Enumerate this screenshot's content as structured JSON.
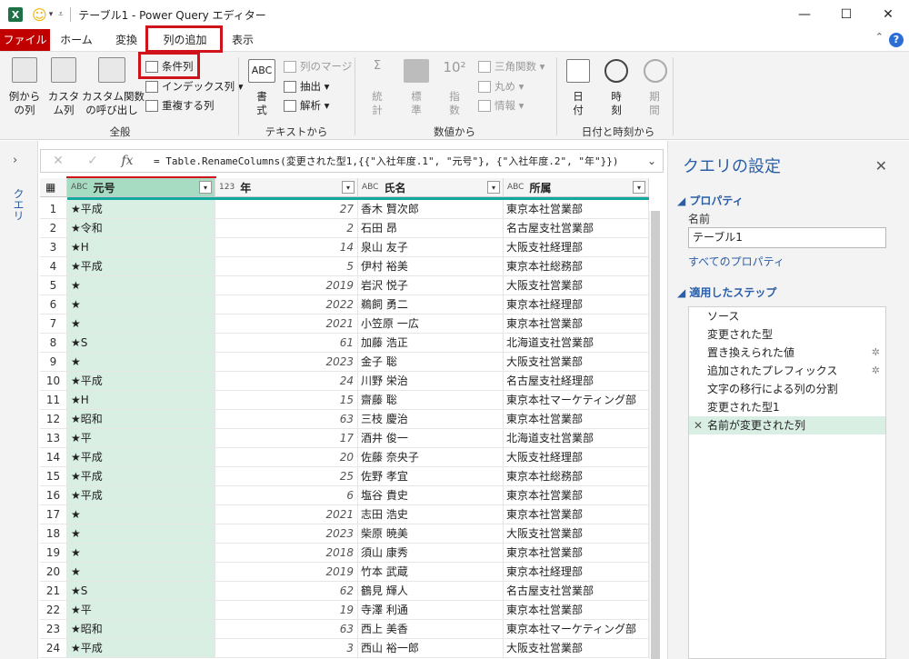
{
  "window": {
    "title": "テーブル1 - Power Query エディター",
    "app_icon": "X",
    "minimize": "—",
    "maximize": "☐",
    "close": "✕"
  },
  "menu": {
    "file": "ファイル",
    "home": "ホーム",
    "transform": "変換",
    "add_column": "列の追加",
    "view": "表示"
  },
  "ribbon": {
    "example_col": "例から\nの列",
    "custom_col": "カスタ\nム列",
    "invoke_func": "カスタム関数\nの呼び出し",
    "conditional_col": "条件列",
    "index_col": "インデックス列",
    "duplicate_col": "重複する列",
    "group_general": "全般",
    "format": "書\n式",
    "merge_cols": "列のマージ",
    "extract": "抽出",
    "parse": "解析",
    "group_text": "テキストから",
    "statistics": "統\n計",
    "standard": "標\n準",
    "scientific": "指\n数",
    "trig": "三角関数",
    "rounding": "丸め",
    "information": "情報",
    "group_number": "数値から",
    "date": "日\n付",
    "time": "時\n刻",
    "duration": "期\n間",
    "group_datetime": "日付と時刻から"
  },
  "formula_bar": {
    "fx": "fx",
    "text": "= Table.RenameColumns(変更された型1,{{\"入社年度.1\", \"元号\"}, {\"入社年度.2\", \"年\"}})",
    "expand": "⌄"
  },
  "query_panel_label": "クエリ",
  "columns": [
    {
      "name": "元号",
      "type": "ABC"
    },
    {
      "name": "年",
      "type": "123"
    },
    {
      "name": "氏名",
      "type": "ABC"
    },
    {
      "name": "所属",
      "type": "ABC"
    }
  ],
  "rows": [
    {
      "idx": "1",
      "gen": "★平成",
      "year": "27",
      "name": "香木 賢次郎",
      "dept": "東京本社営業部"
    },
    {
      "idx": "2",
      "gen": "★令和",
      "year": "2",
      "name": "石田 昂",
      "dept": "名古屋支社営業部"
    },
    {
      "idx": "3",
      "gen": "★H",
      "year": "14",
      "name": "泉山 友子",
      "dept": "大阪支社経理部"
    },
    {
      "idx": "4",
      "gen": "★平成",
      "year": "5",
      "name": "伊村 裕美",
      "dept": "東京本社総務部"
    },
    {
      "idx": "5",
      "gen": "★",
      "year": "2019",
      "name": "岩沢 悦子",
      "dept": "大阪支社営業部"
    },
    {
      "idx": "6",
      "gen": "★",
      "year": "2022",
      "name": "鵜飼 勇二",
      "dept": "東京本社経理部"
    },
    {
      "idx": "7",
      "gen": "★",
      "year": "2021",
      "name": "小笠原 一広",
      "dept": "東京本社営業部"
    },
    {
      "idx": "8",
      "gen": "★S",
      "year": "61",
      "name": "加藤 浩正",
      "dept": "北海道支社営業部"
    },
    {
      "idx": "9",
      "gen": "★",
      "year": "2023",
      "name": "金子 聡",
      "dept": "大阪支社営業部"
    },
    {
      "idx": "10",
      "gen": "★平成",
      "year": "24",
      "name": "川野 栄治",
      "dept": "名古屋支社経理部"
    },
    {
      "idx": "11",
      "gen": "★H",
      "year": "15",
      "name": "齋藤 聡",
      "dept": "東京本社マーケティング部"
    },
    {
      "idx": "12",
      "gen": "★昭和",
      "year": "63",
      "name": "三枝 慶治",
      "dept": "東京本社営業部"
    },
    {
      "idx": "13",
      "gen": "★平",
      "year": "17",
      "name": "酒井 俊一",
      "dept": "北海道支社営業部"
    },
    {
      "idx": "14",
      "gen": "★平成",
      "year": "20",
      "name": "佐藤 奈央子",
      "dept": "大阪支社経理部"
    },
    {
      "idx": "15",
      "gen": "★平成",
      "year": "25",
      "name": "佐野 孝宜",
      "dept": "東京本社総務部"
    },
    {
      "idx": "16",
      "gen": "★平成",
      "year": "6",
      "name": "塩谷 貴史",
      "dept": "東京本社営業部"
    },
    {
      "idx": "17",
      "gen": "★",
      "year": "2021",
      "name": "志田 浩史",
      "dept": "東京本社営業部"
    },
    {
      "idx": "18",
      "gen": "★",
      "year": "2023",
      "name": "柴原 暁美",
      "dept": "大阪支社営業部"
    },
    {
      "idx": "19",
      "gen": "★",
      "year": "2018",
      "name": "須山 康秀",
      "dept": "東京本社営業部"
    },
    {
      "idx": "20",
      "gen": "★",
      "year": "2019",
      "name": "竹本 武蔵",
      "dept": "東京本社経理部"
    },
    {
      "idx": "21",
      "gen": "★S",
      "year": "62",
      "name": "鶴見 輝人",
      "dept": "名古屋支社営業部"
    },
    {
      "idx": "22",
      "gen": "★平",
      "year": "19",
      "name": "寺澤 利通",
      "dept": "東京本社営業部"
    },
    {
      "idx": "23",
      "gen": "★昭和",
      "year": "63",
      "name": "西上 美香",
      "dept": "東京本社マーケティング部"
    },
    {
      "idx": "24",
      "gen": "★平成",
      "year": "3",
      "name": "西山 裕一郎",
      "dept": "大阪支社営業部"
    }
  ],
  "settings": {
    "title": "クエリの設定",
    "properties": "プロパティ",
    "name_label": "名前",
    "name_value": "テーブル1",
    "all_properties": "すべてのプロパティ",
    "applied_steps": "適用したステップ",
    "steps": [
      "ソース",
      "変更された型",
      "置き換えられた値",
      "追加されたプレフィックス",
      "文字の移行による列の分割",
      "変更された型1",
      "名前が変更された列"
    ]
  },
  "colors": {
    "accent": "#13a89e",
    "file_tab": "#c00000",
    "highlight": "#d0121b",
    "selected_column": "#d9efe4"
  }
}
